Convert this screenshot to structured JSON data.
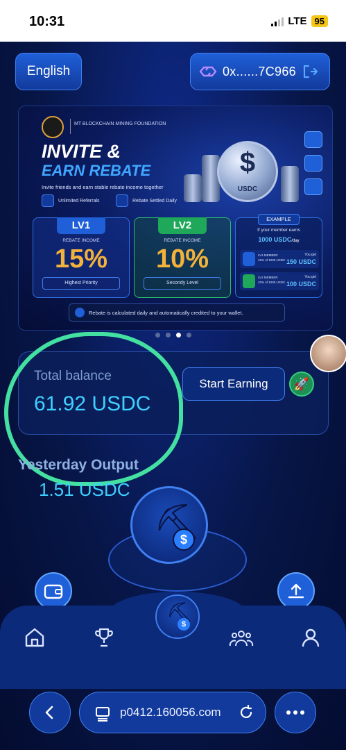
{
  "status": {
    "time": "10:31",
    "network": "LTE",
    "battery": "95"
  },
  "header": {
    "language": "English",
    "wallet_address": "0x......7C966"
  },
  "banner": {
    "org": "MT BLOCKCHAIN MINING FOUNDATION",
    "title1": "INVITE &",
    "title2": "EARN REBATE",
    "subtitle": "Invite friends and earn stable rebate income together",
    "chip1": "Unlimited Referrals",
    "chip2": "Rebate Settled Daily",
    "coin_label": "USDC",
    "lv1": {
      "tag": "LV1",
      "caption": "REBATE INCOME",
      "percent": "15%",
      "note": "Highest Priority"
    },
    "lv2": {
      "tag": "LV2",
      "caption": "REBATE INCOME",
      "percent": "10%",
      "note": "Secondy Level"
    },
    "example": {
      "tag": "EXAMPLE",
      "line1": "If your member earns",
      "amount": "1000 USDC",
      "per": "/day",
      "row1_member": "LV1 MEMBER",
      "row1_of": "15% of 1000 USDC",
      "row1_get_label": "You get",
      "row1_get": "150 USDC",
      "row2_member": "LV2 MEMBER",
      "row2_of": "10% of 1000 USDC",
      "row2_get_label": "You get",
      "row2_get": "100 USDC"
    },
    "footer": "Rebate is calculated daily and automatically credited to your wallet."
  },
  "carousel": {
    "count": 4,
    "active_index": 2
  },
  "balance": {
    "label": "Total balance",
    "value": "61.92 USDC",
    "start_button": "Start Earning"
  },
  "yesterday": {
    "label": "Yesterday Output",
    "value": "1.51 USDC"
  },
  "browser": {
    "url": "p0412.160056.com"
  },
  "colors": {
    "accent": "#3fd0ff",
    "highlight": "#44e0a2",
    "gold": "#f3b23b"
  }
}
